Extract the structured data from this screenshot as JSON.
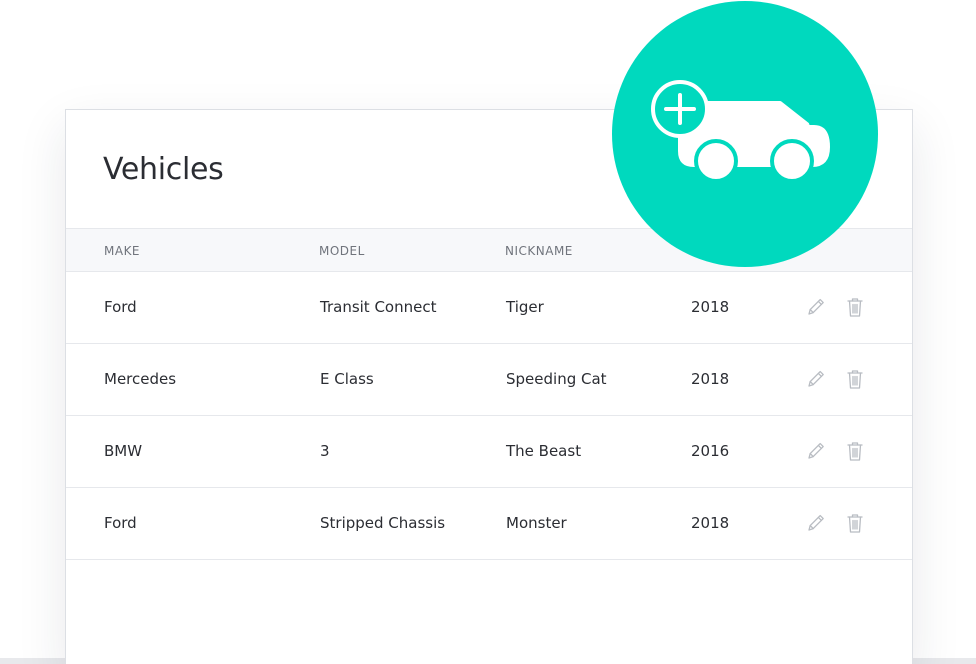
{
  "page": {
    "title": "Vehicles"
  },
  "table": {
    "columns": [
      "MAKE",
      "MODEL",
      "NICKNAME"
    ],
    "rows": [
      {
        "make": "Ford",
        "model": "Transit Connect",
        "nickname": "Tiger",
        "year": "2018"
      },
      {
        "make": "Mercedes",
        "model": "E Class",
        "nickname": "Speeding Cat",
        "year": "2018"
      },
      {
        "make": "BMW",
        "model": "3",
        "nickname": "The Beast",
        "year": "2016"
      },
      {
        "make": "Ford",
        "model": "Stripped Chassis",
        "nickname": "Monster",
        "year": "2018"
      }
    ]
  },
  "actions": {
    "add_vehicle_icon": "car-plus-icon",
    "edit_icon": "pencil-icon",
    "delete_icon": "trash-icon"
  },
  "colors": {
    "accent": "#00d9be",
    "header_bg": "#f7f8fa",
    "icon_gray": "#b8bcc2"
  }
}
